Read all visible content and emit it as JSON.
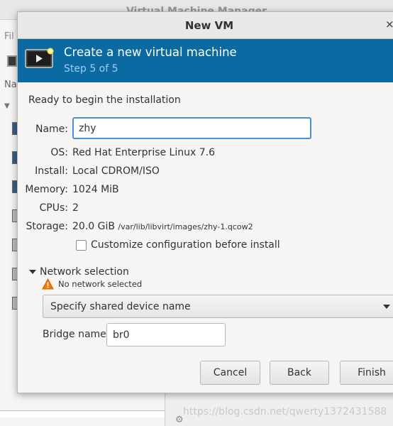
{
  "background_window": {
    "title": "Virtual Machine Manager",
    "menu_fragment": "Fil",
    "column_fragment": "Na"
  },
  "dialog": {
    "title": "New VM",
    "close_glyph": "×"
  },
  "banner": {
    "title": "Create a new virtual machine",
    "step": "Step 5 of 5",
    "color": "#0b6aa2"
  },
  "summary": {
    "ready_text": "Ready to begin the installation",
    "name_label": "Name:",
    "name_value": "zhy",
    "os_label": "OS:",
    "os_value": "Red Hat Enterprise Linux 7.6",
    "install_label": "Install:",
    "install_value": "Local CDROM/ISO",
    "memory_label": "Memory:",
    "memory_value": "1024 MiB",
    "cpus_label": "CPUs:",
    "cpus_value": "2",
    "storage_label": "Storage:",
    "storage_size": "20.0 GiB",
    "storage_path": "/var/lib/libvirt/images/zhy-1.qcow2"
  },
  "customize": {
    "label": "Customize configuration before install",
    "checked": false
  },
  "network": {
    "expander_label": "Network selection",
    "warning_icon": "warning-icon",
    "warning_text": "No network selected",
    "source_selected": "Specify shared device name",
    "bridge_label": "Bridge name:",
    "bridge_value": "br0"
  },
  "buttons": {
    "cancel": "Cancel",
    "back": "Back",
    "finish": "Finish"
  },
  "watermark": "https://blog.csdn.net/qwerty1372431588"
}
